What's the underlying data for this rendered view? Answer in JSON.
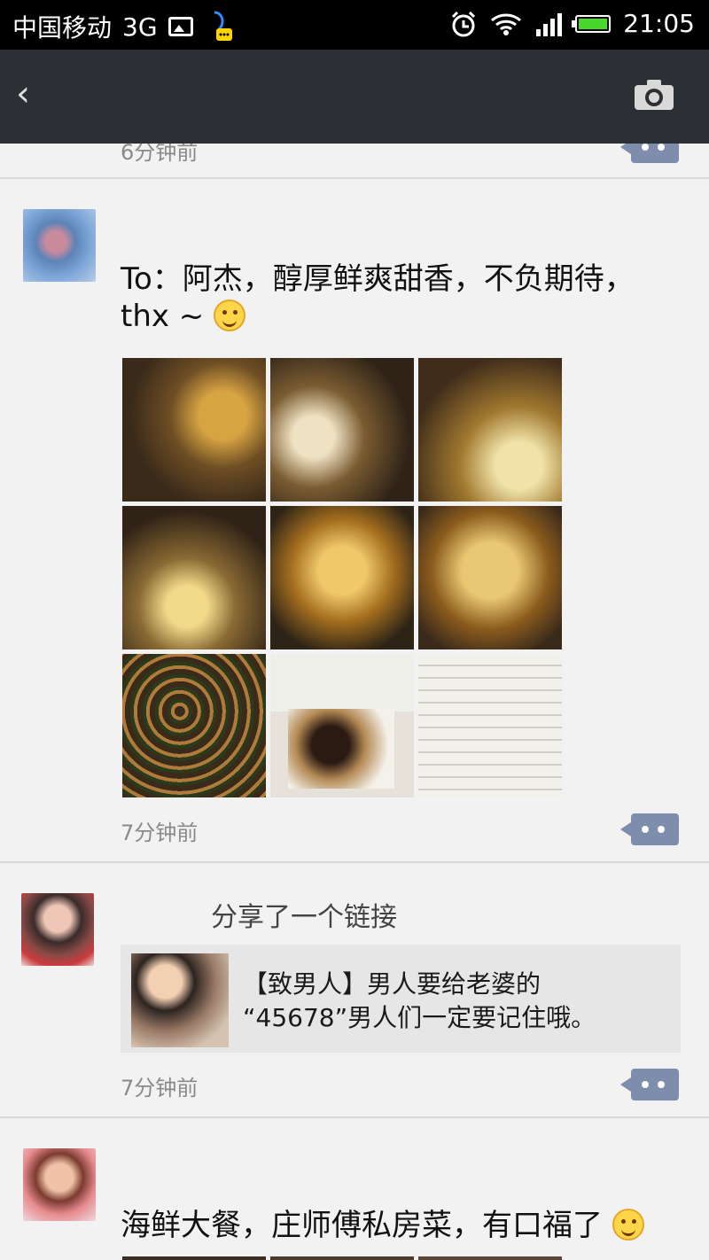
{
  "status_bar": {
    "carrier": "中国移动",
    "network": "3G",
    "time": "21:05",
    "battery_level": 0.9
  },
  "nav": {
    "back_glyph": "‹",
    "camera_icon": "camera-icon"
  },
  "feed": {
    "previous_post_time": "6分钟前",
    "posts": [
      {
        "text_line1": "To：阿杰，醇厚鲜爽甜香，不负期待，",
        "text_line2": "thx ~",
        "emoji": "smile-emoji",
        "image_count": 9,
        "time": "7分钟前"
      },
      {
        "share_label": "分享了一个链接",
        "link_title_line1": "【致男人】男人要给老婆的",
        "link_title_line2": "“45678”男人们一定要记住哦。",
        "time": "7分钟前"
      },
      {
        "text": "海鲜大餐，庄师傅私房菜，有口福了",
        "emoji": "grin-emoji"
      }
    ]
  },
  "colors": {
    "status_bar_bg": "#000000",
    "nav_bg": "#2c2f33",
    "comment_button": "#7e8dab",
    "feed_bg": "#f2f2f2",
    "link_card_bg": "#e6e6e6"
  }
}
